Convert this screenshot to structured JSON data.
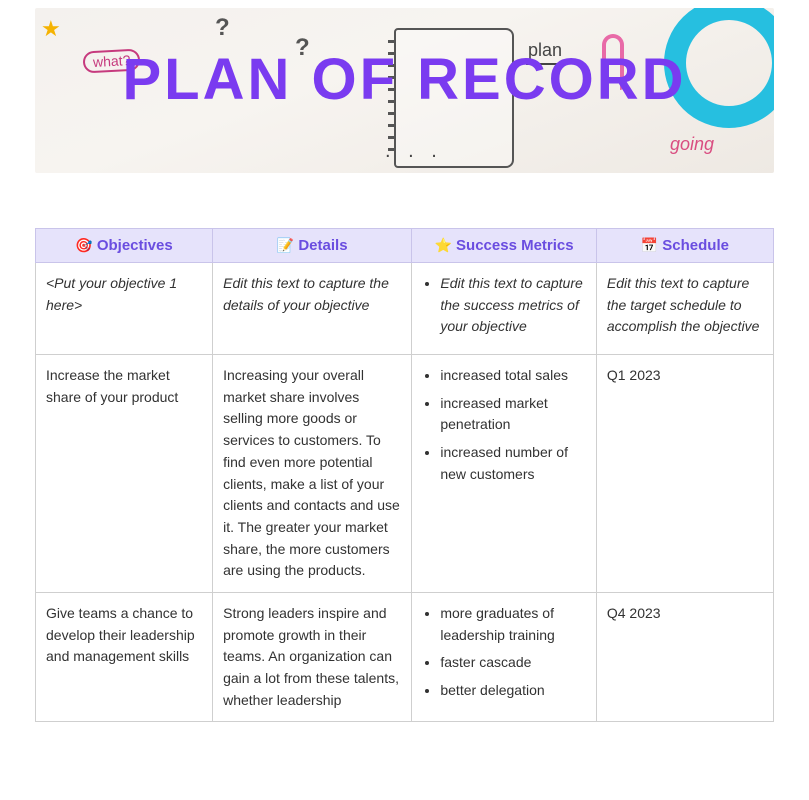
{
  "banner": {
    "title": "PLAN OF RECORD",
    "scribble_what": "what?",
    "scribble_plan": "plan",
    "scribble_going": "going",
    "scribble_dots": ". . ."
  },
  "table": {
    "headers": {
      "objectives_icon": "🎯",
      "objectives": "Objectives",
      "details_icon": "📝",
      "details": "Details",
      "metrics_icon": "⭐",
      "metrics": "Success Metrics",
      "schedule_icon": "📅",
      "schedule": "Schedule"
    },
    "rows": [
      {
        "objective": "<Put your objective 1 here>",
        "objective_placeholder": true,
        "details": "Edit this text to capture the details of your objective",
        "details_placeholder": true,
        "metrics": [
          "Edit this text to capture the success metrics of your objective"
        ],
        "metrics_placeholder": true,
        "schedule": "Edit this text to capture the target schedule to accomplish the objective",
        "schedule_placeholder": true
      },
      {
        "objective": "Increase the market share of your product",
        "details": "Increasing your overall market share involves selling more goods or services to customers. To find even more potential clients, make a list of your clients and contacts and use it. The greater your market share, the more customers are using the products.",
        "metrics": [
          "increased total sales",
          "increased market penetration",
          "increased number of new customers"
        ],
        "schedule": "Q1 2023"
      },
      {
        "objective": "Give teams a chance to develop their leadership and management skills",
        "details": "Strong leaders inspire and promote growth in their teams. An organization can gain a lot from these talents, whether leadership",
        "metrics": [
          "more graduates of leadership training",
          "faster cascade",
          "better delegation"
        ],
        "schedule": "Q4 2023"
      }
    ]
  }
}
